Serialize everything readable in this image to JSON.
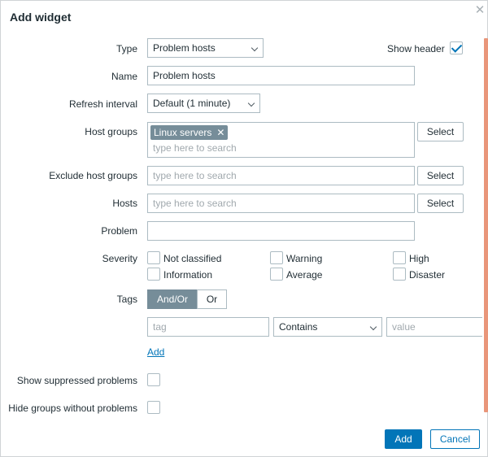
{
  "dialog": {
    "title": "Add widget",
    "close_icon": "close-icon",
    "accent_color": "#0275b8",
    "scrollbar_color": "#e9967a"
  },
  "form": {
    "type": {
      "label": "Type",
      "value": "Problem hosts"
    },
    "show_header": {
      "label": "Show header",
      "checked": true
    },
    "name": {
      "label": "Name",
      "value": "Problem hosts"
    },
    "refresh_interval": {
      "label": "Refresh interval",
      "value": "Default (1 minute)"
    },
    "host_groups": {
      "label": "Host groups",
      "selected": [
        "Linux servers"
      ],
      "placeholder": "type here to search",
      "select_label": "Select"
    },
    "exclude_host_groups": {
      "label": "Exclude host groups",
      "placeholder": "type here to search",
      "select_label": "Select"
    },
    "hosts": {
      "label": "Hosts",
      "placeholder": "type here to search",
      "select_label": "Select"
    },
    "problem": {
      "label": "Problem",
      "value": ""
    },
    "severity": {
      "label": "Severity",
      "options": [
        {
          "label": "Not classified",
          "checked": false
        },
        {
          "label": "Warning",
          "checked": false
        },
        {
          "label": "High",
          "checked": false
        },
        {
          "label": "Information",
          "checked": false
        },
        {
          "label": "Average",
          "checked": false
        },
        {
          "label": "Disaster",
          "checked": false
        }
      ]
    },
    "tags": {
      "label": "Tags",
      "modes": [
        "And/Or",
        "Or"
      ],
      "active_mode": "And/Or",
      "row": {
        "tag_placeholder": "tag",
        "operator": "Contains",
        "value_placeholder": "value"
      },
      "add_label": "Add"
    },
    "show_suppressed": {
      "label": "Show suppressed problems",
      "checked": false
    },
    "hide_groups": {
      "label": "Hide groups without problems",
      "checked": false
    }
  },
  "footer": {
    "add_label": "Add",
    "cancel_label": "Cancel"
  }
}
